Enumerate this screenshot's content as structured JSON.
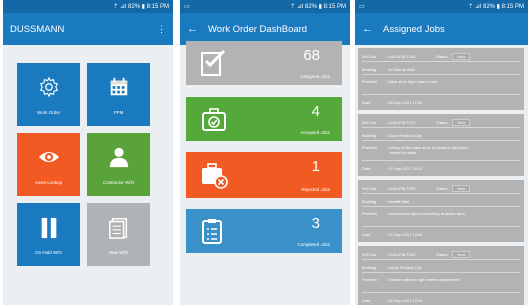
{
  "status_bar": {
    "text": "⇡ ⊿l 82% ▮ 8:15 PM",
    "sim_icon": "sim-icon"
  },
  "screen1": {
    "title": "DUSSMANN",
    "menu_icon": "⋮",
    "tiles": [
      {
        "label": "Work Order",
        "color": "#1a7ac0",
        "icon": "gear-icon"
      },
      {
        "label": "PPM",
        "color": "#1a7ac0",
        "icon": "calendar-icon"
      },
      {
        "label": "Asset Lookup",
        "color": "#f15a22",
        "icon": "eye-icon"
      },
      {
        "label": "Contractor W/O",
        "color": "#5aa33a",
        "icon": "person-icon"
      },
      {
        "label": "On Hold W/O",
        "color": "#1a7ac0",
        "icon": "pause-icon"
      },
      {
        "label": "New W/O",
        "color": "#b0b3b5",
        "icon": "document-icon"
      }
    ]
  },
  "screen2": {
    "title": "Work Order DashBoard",
    "cards": [
      {
        "num": "68",
        "label": "Assigned Jobs",
        "color": "#b3b3b3",
        "icon": "checklist-icon"
      },
      {
        "num": "4",
        "label": "Accepted Jobs",
        "color": "#55a83a",
        "icon": "briefcase-check-icon"
      },
      {
        "num": "1",
        "label": "Rejected Jobs",
        "color": "#f15a22",
        "icon": "briefcase-x-icon"
      },
      {
        "num": "3",
        "label": "Completed Jobs",
        "color": "#3a91c9",
        "icon": "clipboard-icon"
      }
    ]
  },
  "screen3": {
    "title": "Assigned Jobs",
    "labels": {
      "wo": "W/O No",
      "status": "Status",
      "building": "Building",
      "problem": "Problem",
      "date": "Date"
    },
    "jobs": [
      {
        "wo": ": LMG-IFM-T264",
        "status": "New",
        "building": ": Al Ghurair Mall",
        "problem": ": Back store light fused 4 nos.",
        "problem2": "",
        "date": ": 08-Sep-2017 17:24"
      },
      {
        "wo": ": LMG-IFM-T210",
        "status": "New",
        "building": ": Dubai Festival City",
        "problem": ": Ceiling at the back store is about to fall down -",
        "problem2": "needs to repair",
        "date": ": 07-Sep-2017 20:31"
      },
      {
        "wo": ": LMG-IFM-T203",
        "status": "New",
        "building": ": Mardiff Mall",
        "problem": ": Accessories light not working at ladies area",
        "problem2": "",
        "date": ": 07-Sep-2017 19:08"
      },
      {
        "wo": ": LMG-IFM-T240",
        "status": "New",
        "building": ": Dubai Festival City",
        "problem": ": Fashion window light needs replacement",
        "problem2": "",
        "date": ": 06-Sep-2017 12:41"
      }
    ]
  }
}
